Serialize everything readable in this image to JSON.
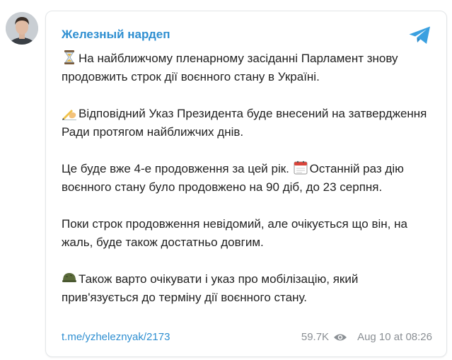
{
  "channel": {
    "name": "Железный нардеп"
  },
  "paragraphs": [
    "На найближчому пленарному засіданні Парламент знову продовжить строк дії воєнного стану в Україні.",
    "Відповідний Указ Президента буде внесений на затвердження Ради протягом найближчих днів.",
    [
      "Це буде вже 4-е продовження за цей рік. ",
      "Останній раз дію воєнного стану було продовжено на 90 діб, до 23 серпня."
    ],
    "Поки строк продовження невідомий, але очікується що він, на жаль, буде також достатньо довгим.",
    "Також варто очікувати і указ про мобілізацію, який прив'язується до терміну дії воєнного стану."
  ],
  "emojis": [
    "hourglass-icon",
    "writing-hand-icon",
    "calendar-icon",
    "military-helmet-icon"
  ],
  "footer": {
    "link": "t.me/yzheleznyak/2173",
    "views": "59.7K",
    "date": "Aug 10 at 08:26"
  },
  "colors": {
    "accent": "#2f8fd1",
    "text": "#222222",
    "muted": "#8a8f94",
    "border": "#e3e6e8"
  }
}
